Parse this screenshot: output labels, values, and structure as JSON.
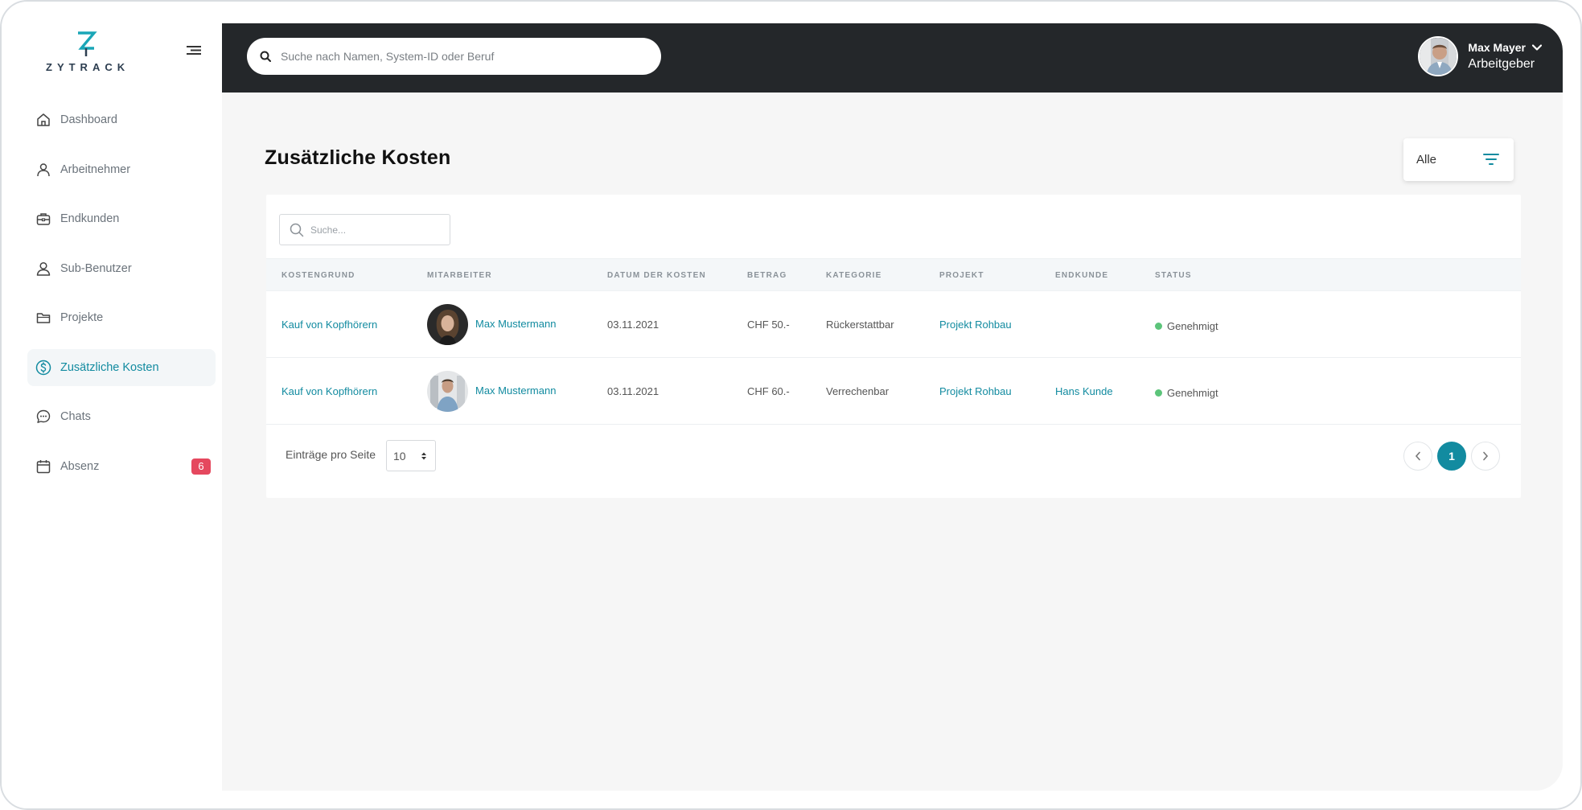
{
  "brand": {
    "name": "ZYTRACK",
    "accent": "#128ba0"
  },
  "sidebar": {
    "items": [
      {
        "label": "Dashboard",
        "icon": "home-icon"
      },
      {
        "label": "Arbeitnehmer",
        "icon": "user-icon"
      },
      {
        "label": "Endkunden",
        "icon": "briefcase-icon"
      },
      {
        "label": "Sub-Benutzer",
        "icon": "user-outline-icon"
      },
      {
        "label": "Projekte",
        "icon": "folder-icon"
      },
      {
        "label": "Zusätzliche Kosten",
        "icon": "dollar-circle-icon",
        "active": true
      },
      {
        "label": "Chats",
        "icon": "chat-icon"
      },
      {
        "label": "Absenz",
        "icon": "calendar-icon",
        "badge": "6"
      }
    ]
  },
  "topbar": {
    "search_placeholder": "Suche nach Namen, System-ID oder Beruf",
    "user_name": "Max Mayer",
    "user_role": "Arbeitgeber"
  },
  "page": {
    "title": "Zusätzliche Kosten",
    "filter_label": "Alle"
  },
  "table": {
    "search_placeholder": "Suche...",
    "columns": [
      "KOSTENGRUND",
      "MITARBEITER",
      "DATUM DER KOSTEN",
      "BETRAG",
      "KATEGORIE",
      "PROJEKT",
      "ENDKUNDE",
      "STATUS"
    ],
    "rows": [
      {
        "reason": "Kauf von Kopfhörern",
        "employee": "Max Mustermann",
        "date": "03.11.2021",
        "amount": "CHF 50.-",
        "category": "Rückerstattbar",
        "project": "Projekt Rohbau",
        "customer": "",
        "status": "Genehmigt"
      },
      {
        "reason": "Kauf von Kopfhörern",
        "employee": "Max Mustermann",
        "date": "03.11.2021",
        "amount": "CHF 60.-",
        "category": "Verrechenbar",
        "project": "Projekt Rohbau",
        "customer": "Hans Kunde",
        "status": "Genehmigt"
      }
    ],
    "per_page_label": "Einträge pro Seite",
    "per_page_value": "10",
    "current_page": "1"
  }
}
